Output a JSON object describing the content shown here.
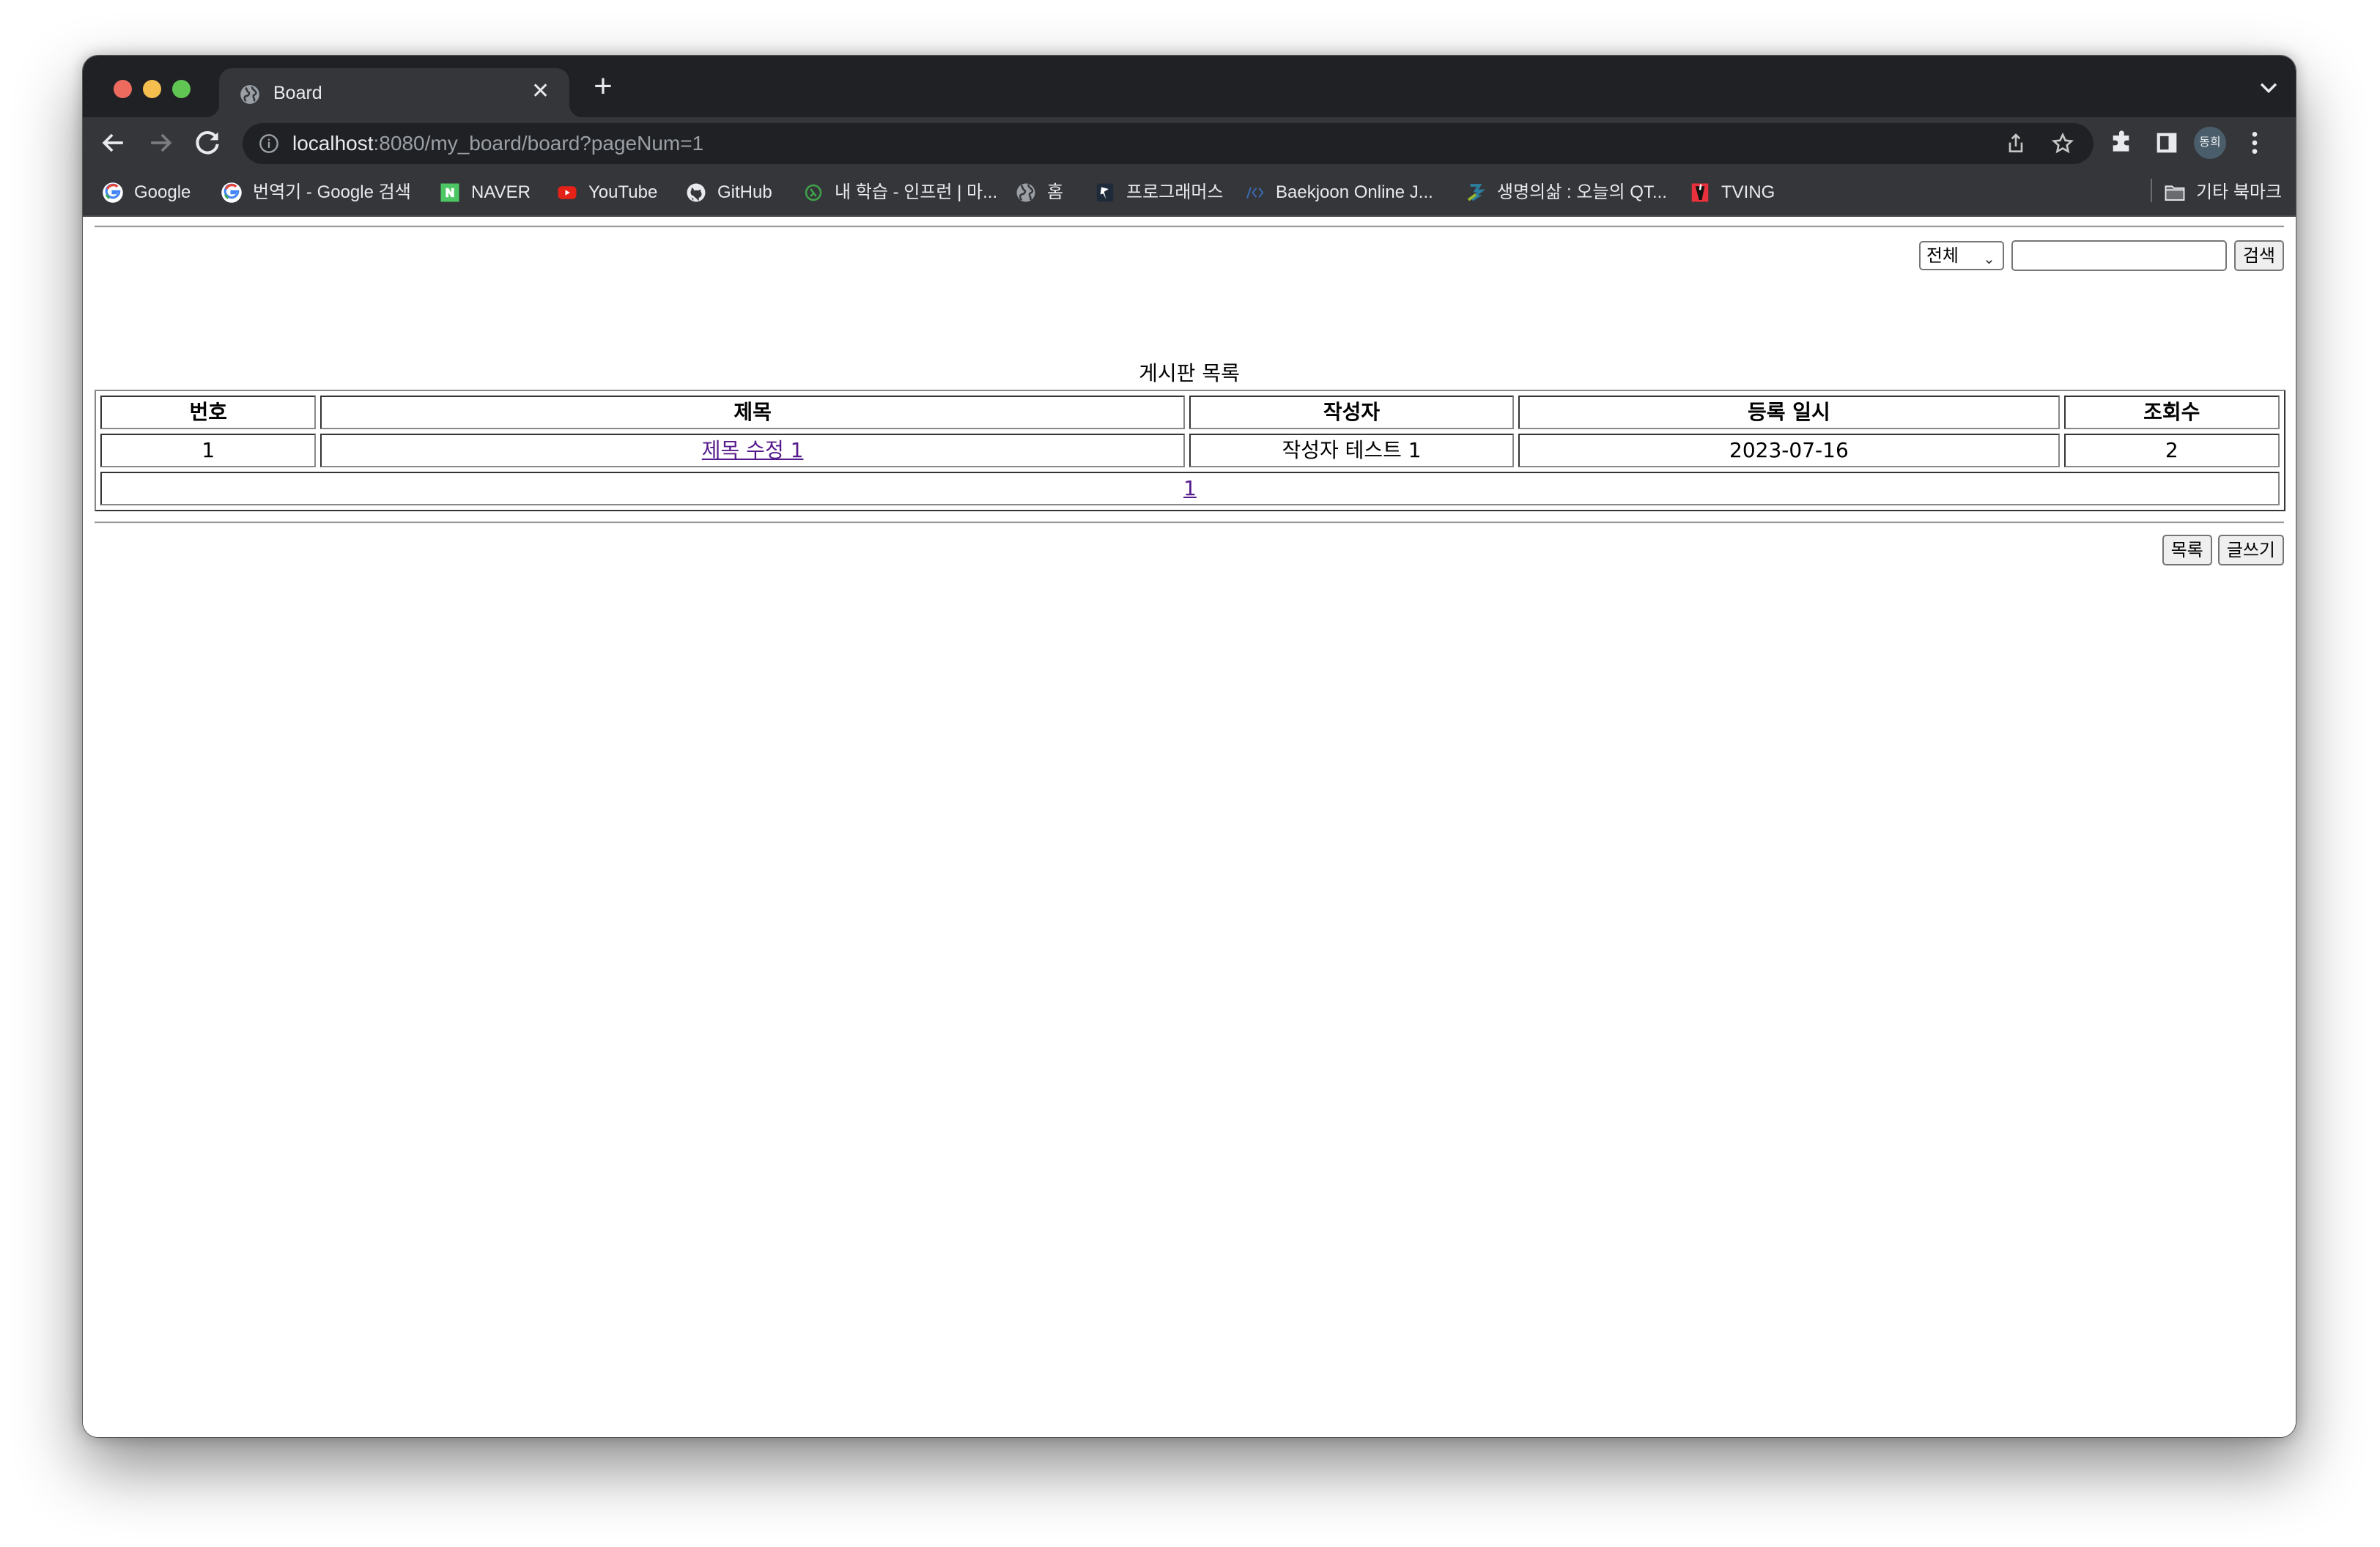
{
  "browser": {
    "tab": {
      "title": "Board",
      "favicon": "globe-icon"
    },
    "url": {
      "host": "localhost",
      "rest": ":8080/my_board/board?pageNum=1"
    },
    "profile_initials": "동희",
    "bookmarks": [
      {
        "label": "Google",
        "icon": "google-icon"
      },
      {
        "label": "번역기 - Google 검색",
        "icon": "google-icon"
      },
      {
        "label": "NAVER",
        "icon": "naver-icon"
      },
      {
        "label": "YouTube",
        "icon": "youtube-icon"
      },
      {
        "label": "GitHub",
        "icon": "github-icon"
      },
      {
        "label": "내 학습 - 인프런 | 마...",
        "icon": "inflearn-icon"
      },
      {
        "label": "홈",
        "icon": "globe-icon"
      },
      {
        "label": "프로그래머스",
        "icon": "programmers-icon"
      },
      {
        "label": "Baekjoon Online J...",
        "icon": "code-icon"
      },
      {
        "label": "생명의삶 : 오늘의 QT...",
        "icon": "qt-icon"
      },
      {
        "label": "TVING",
        "icon": "tving-icon"
      }
    ],
    "other_bookmarks": "기타 북마크"
  },
  "page": {
    "search": {
      "select_value": "전체",
      "input_value": "",
      "button": "검색"
    },
    "caption": "게시판 목록",
    "table": {
      "headers": [
        "번호",
        "제목",
        "작성자",
        "등록 일시",
        "조회수"
      ],
      "rows": [
        {
          "no": "1",
          "title": "제목 수정 1",
          "author": "작성자 테스트 1",
          "date": "2023-07-16",
          "views": "2"
        }
      ],
      "pages": [
        "1"
      ]
    },
    "buttons": {
      "list": "목록",
      "write": "글쓰기"
    }
  },
  "colors": {
    "link_visited": "#551a8b",
    "chrome_dark": "#202124",
    "chrome_toolbar": "#35363a"
  }
}
